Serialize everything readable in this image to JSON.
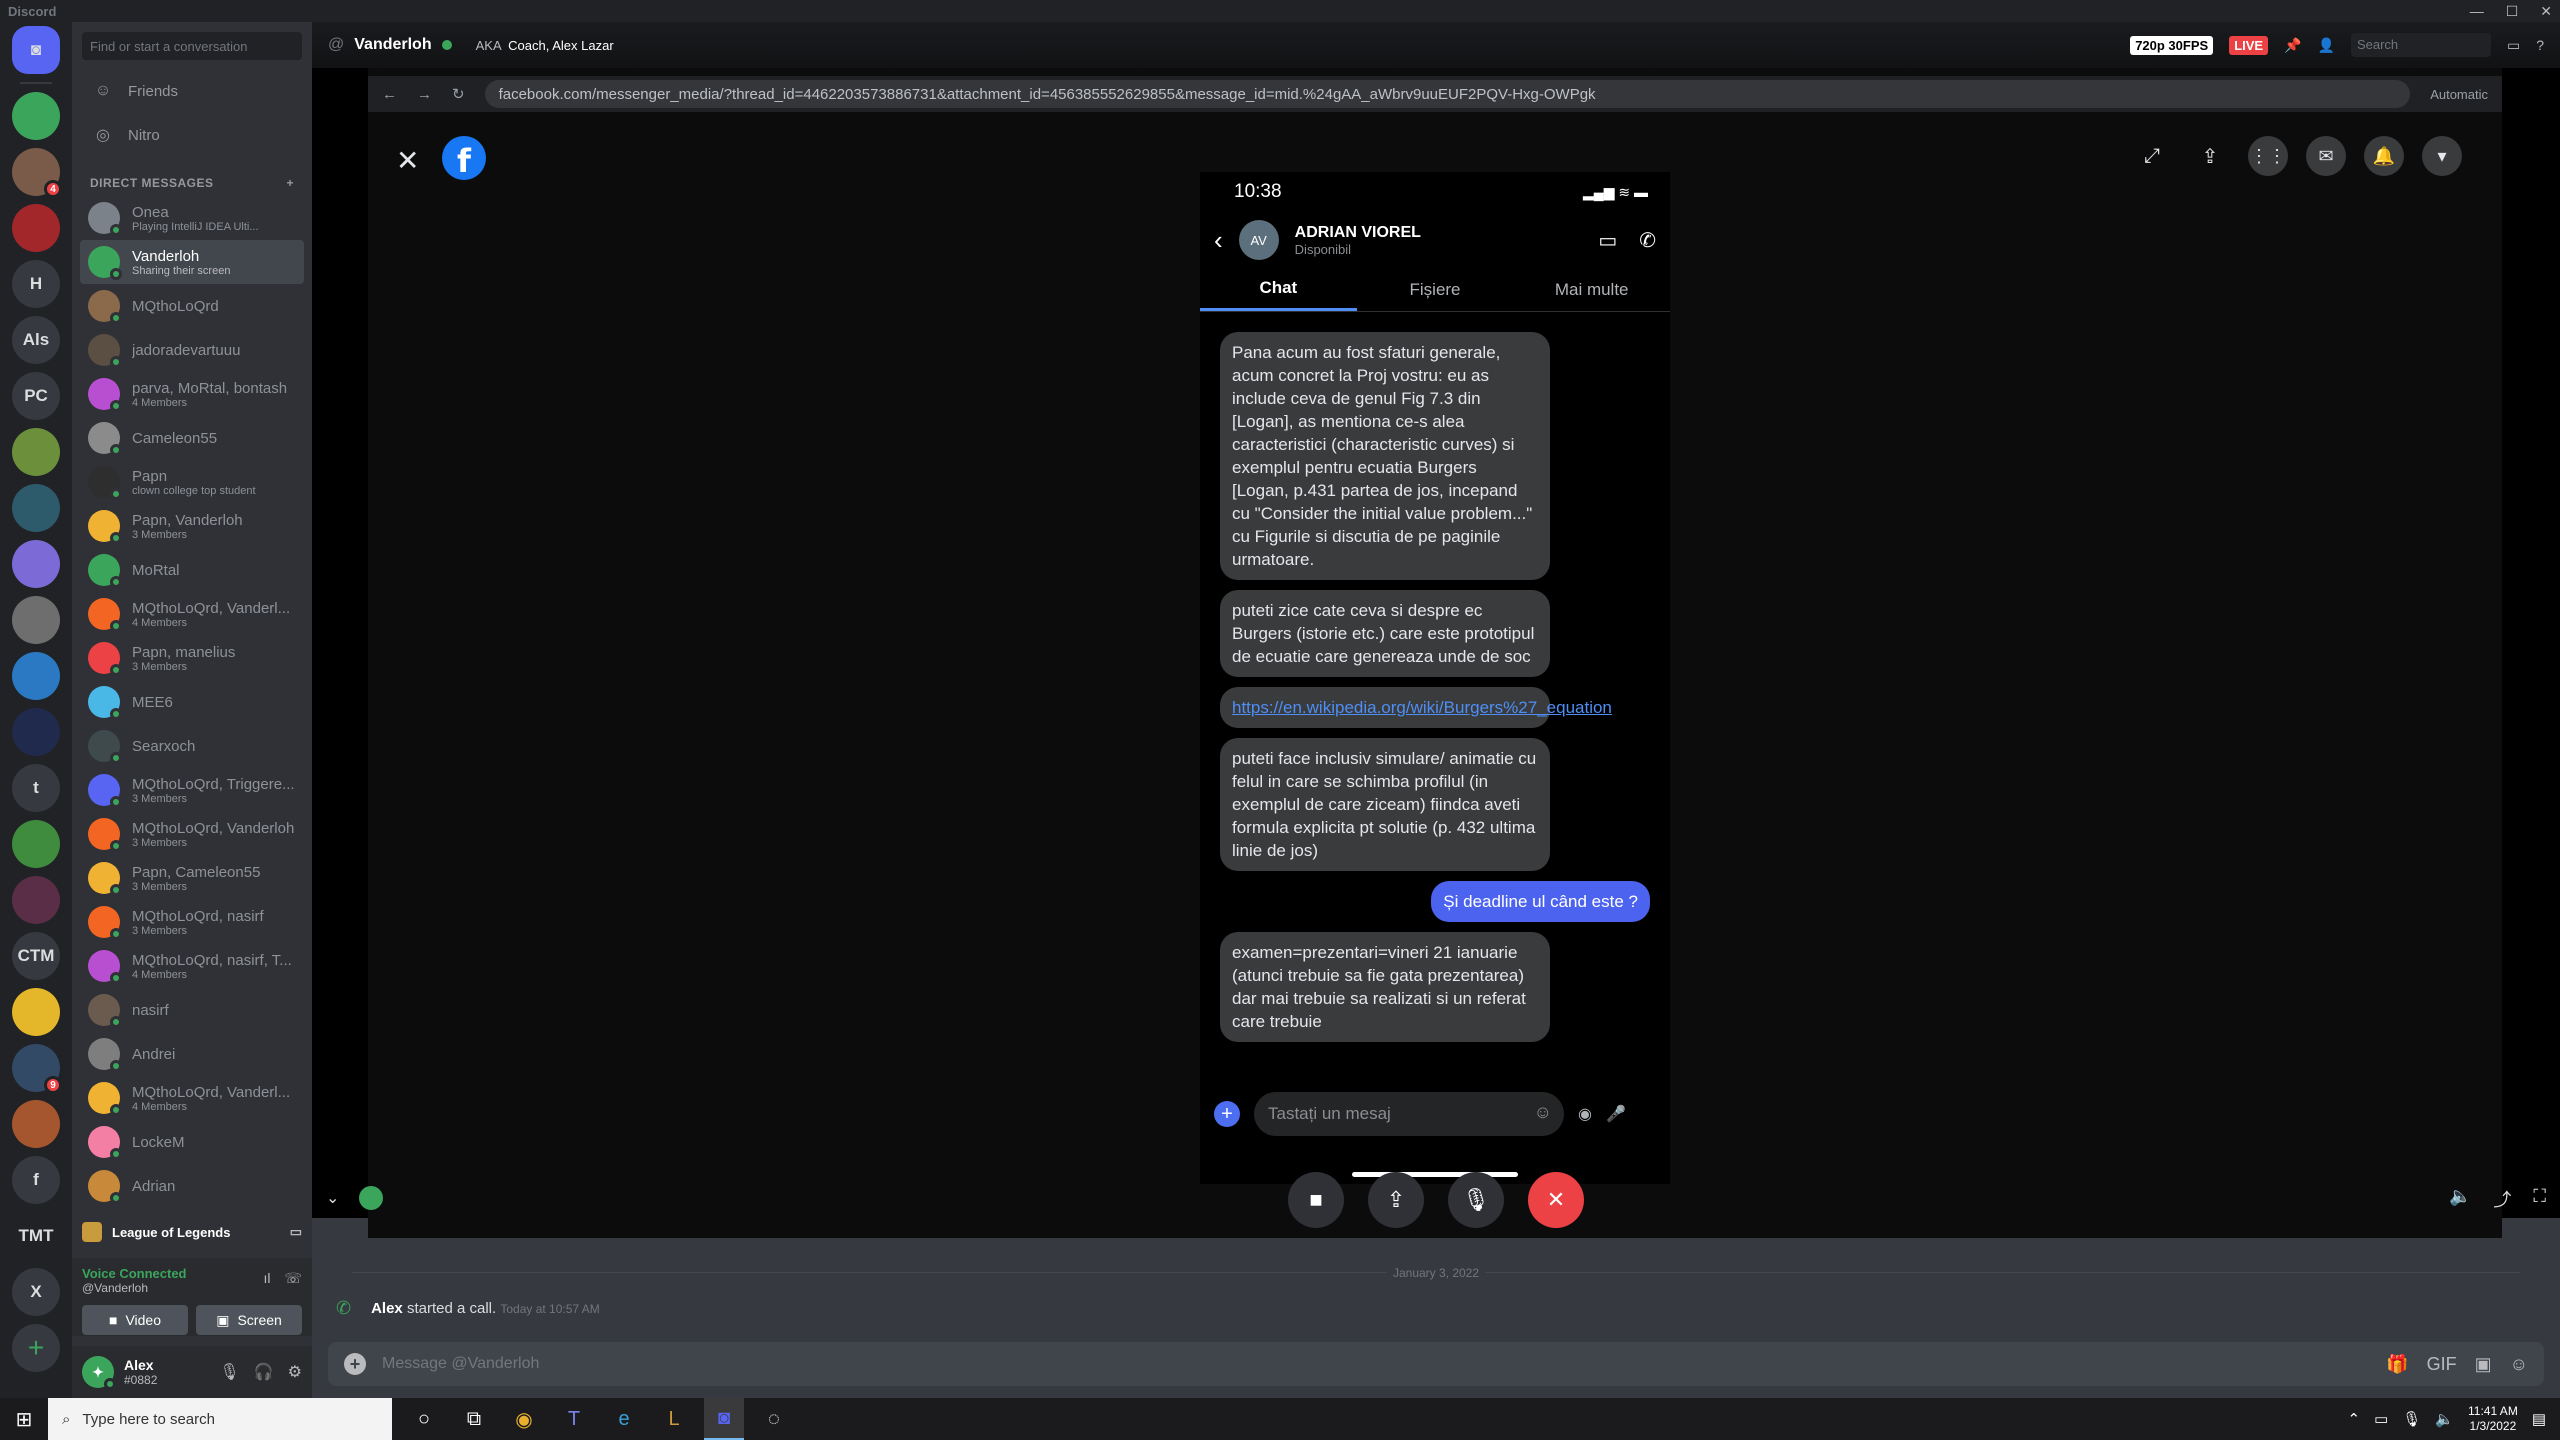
{
  "app": {
    "title": "Discord"
  },
  "servers": [
    {
      "label": "",
      "icon": "discord-home-icon",
      "color": "#5865f2"
    },
    {
      "label": "",
      "icon": "server-avatar",
      "color": "#3ba55c"
    },
    {
      "label": "",
      "icon": "server-avatar",
      "color": "#7a5a48",
      "badge": "4"
    },
    {
      "label": "",
      "icon": "server-avatar",
      "color": "#a1272b"
    },
    {
      "label": "H",
      "color": "#36393f"
    },
    {
      "label": "Als",
      "color": "#36393f"
    },
    {
      "label": "PC",
      "color": "#36393f"
    },
    {
      "label": "",
      "icon": "server-avatar",
      "color": "#6b8f3a"
    },
    {
      "label": "",
      "icon": "server-avatar",
      "color": "#2d5b6b"
    },
    {
      "label": "",
      "icon": "server-avatar",
      "color": "#7c6ad6"
    },
    {
      "label": "",
      "icon": "server-avatar",
      "color": "#6e6e6e"
    },
    {
      "label": "",
      "icon": "server-avatar",
      "color": "#2b79c2"
    },
    {
      "label": "",
      "icon": "server-avatar",
      "color": "#1f2a4d"
    },
    {
      "label": "t",
      "color": "#36393f"
    },
    {
      "label": "",
      "icon": "server-avatar",
      "color": "#3f8c3f"
    },
    {
      "label": "",
      "icon": "server-avatar",
      "color": "#5a2e46"
    },
    {
      "label": "CTM",
      "color": "#36393f"
    },
    {
      "label": "",
      "icon": "server-avatar",
      "color": "#e3b729"
    },
    {
      "label": "",
      "icon": "server-avatar",
      "color": "#334a66",
      "badge": "9"
    },
    {
      "label": "",
      "icon": "server-avatar",
      "color": "#a5562e"
    },
    {
      "label": "f",
      "color": "#36393f"
    },
    {
      "label": "TMT",
      "color": "#202225"
    },
    {
      "label": "X",
      "color": "#36393f"
    }
  ],
  "sidebar": {
    "search_placeholder": "Find or start a conversation",
    "friends": "Friends",
    "nitro": "Nitro",
    "dm_header": "DIRECT MESSAGES",
    "dms": [
      {
        "name": "Onea",
        "sub": "Playing IntelliJ IDEA Ulti...",
        "color": "#7b8289"
      },
      {
        "name": "Vanderloh",
        "sub": "Sharing their screen",
        "color": "#3ba55c",
        "active": true
      },
      {
        "name": "MQthoLoQrd",
        "sub": "",
        "color": "#8a6a4b"
      },
      {
        "name": "jadoradevartuuu",
        "sub": "",
        "color": "#5b4e43"
      },
      {
        "name": "parva, MoRtal, bontash",
        "sub": "4 Members",
        "color": "#b84fd1"
      },
      {
        "name": "Cameleon55",
        "sub": "",
        "color": "#8b8b8b"
      },
      {
        "name": "Papn",
        "sub": "clown college top student",
        "color": "#2e2e2e"
      },
      {
        "name": "Papn, Vanderloh",
        "sub": "3 Members",
        "color": "#f0b232"
      },
      {
        "name": "MoRtal",
        "sub": "",
        "color": "#3ba55c"
      },
      {
        "name": "MQthoLoQrd, Vanderl...",
        "sub": "4 Members",
        "color": "#f26522"
      },
      {
        "name": "Papn, manelius",
        "sub": "3 Members",
        "color": "#ed4245"
      },
      {
        "name": "MEE6",
        "sub": "",
        "color": "#49b8e6"
      },
      {
        "name": "Searxoch",
        "sub": "",
        "color": "#3f4a4d"
      },
      {
        "name": "MQthoLoQrd, Triggere...",
        "sub": "3 Members",
        "color": "#5865f2"
      },
      {
        "name": "MQthoLoQrd, Vanderloh",
        "sub": "3 Members",
        "color": "#f26522"
      },
      {
        "name": "Papn, Cameleon55",
        "sub": "3 Members",
        "color": "#f0b232"
      },
      {
        "name": "MQthoLoQrd, nasirf",
        "sub": "3 Members",
        "color": "#f26522"
      },
      {
        "name": "MQthoLoQrd, nasirf, T...",
        "sub": "4 Members",
        "color": "#b84fd1"
      },
      {
        "name": "nasirf",
        "sub": "",
        "color": "#6b5a4e"
      },
      {
        "name": "Andrei",
        "sub": "",
        "color": "#7e7e7e"
      },
      {
        "name": "MQthoLoQrd, Vanderl...",
        "sub": "4 Members",
        "color": "#f0b232"
      },
      {
        "name": "LockeM",
        "sub": "",
        "color": "#f47fa4"
      },
      {
        "name": "Adrian",
        "sub": "",
        "color": "#c88a3a"
      }
    ],
    "game_activity": "League of Legends",
    "voice_status": "Voice Connected",
    "voice_channel": "@Vanderloh",
    "video_btn": "Video",
    "screen_btn": "Screen",
    "user": {
      "name": "Alex",
      "tag": "#0882"
    }
  },
  "call": {
    "name": "Vanderloh",
    "aka_label": "AKA",
    "aka": "Coach, Alex Lazar",
    "quality": "720p 30FPS",
    "live": "LIVE",
    "search_placeholder": "Search"
  },
  "browser": {
    "url": "facebook.com/messenger_media/?thread_id=4462203573886731&attachment_id=456385552629855&message_id=mid.%24gAA_aWbrv9uuEUF2PQV-Hxg-OWPgk",
    "zoom": "Automatic"
  },
  "phone": {
    "time": "10:38",
    "contact": "ADRIAN VIOREL",
    "contact_initials": "AV",
    "presence": "Disponibil",
    "tabs": [
      "Chat",
      "Fișiere",
      "Mai multe"
    ],
    "messages": [
      {
        "text": "Pana acum au fost sfaturi generale, acum concret la Proj vostru: eu as include ceva de genul Fig 7.3 din [Logan], as mentiona ce-s alea caracteristici (characteristic curves) si exemplul pentru ecuatia Burgers [Logan, p.431 partea de jos, incepand cu \"Consider the initial value problem...\" cu Figurile si discutia de pe paginile urmatoare.",
        "me": false
      },
      {
        "text": "puteti zice cate ceva si despre ec Burgers (istorie etc.) care este prototipul de ecuatie care genereaza unde de soc",
        "me": false
      },
      {
        "text": "https://en.wikipedia.org/wiki/Burgers%27_equation",
        "me": false,
        "link": true
      },
      {
        "text": "puteti face inclusiv simulare/ animatie cu felul in care se schimba profilul (in exemplul de care ziceam) fiindca aveti formula explicita pt solutie (p. 432 ultima linie de jos)",
        "me": false
      },
      {
        "text": "Și deadline ul când este ?",
        "me": true
      },
      {
        "text": "examen=prezentari=vineri 21 ianuarie (atunci trebuie sa fie gata prezentarea) dar mai trebuie sa realizati si un referat care trebuie",
        "me": false
      }
    ],
    "input_placeholder": "Tastați un mesaj"
  },
  "chat": {
    "date": "January 3, 2022",
    "caller": "Alex",
    "call_text": "started a call.",
    "call_time": "Today at 10:57 AM",
    "composer_placeholder": "Message @Vanderloh"
  },
  "taskbar": {
    "search_placeholder": "Type here to search",
    "time": "11:41 AM",
    "date": "1/3/2022"
  }
}
